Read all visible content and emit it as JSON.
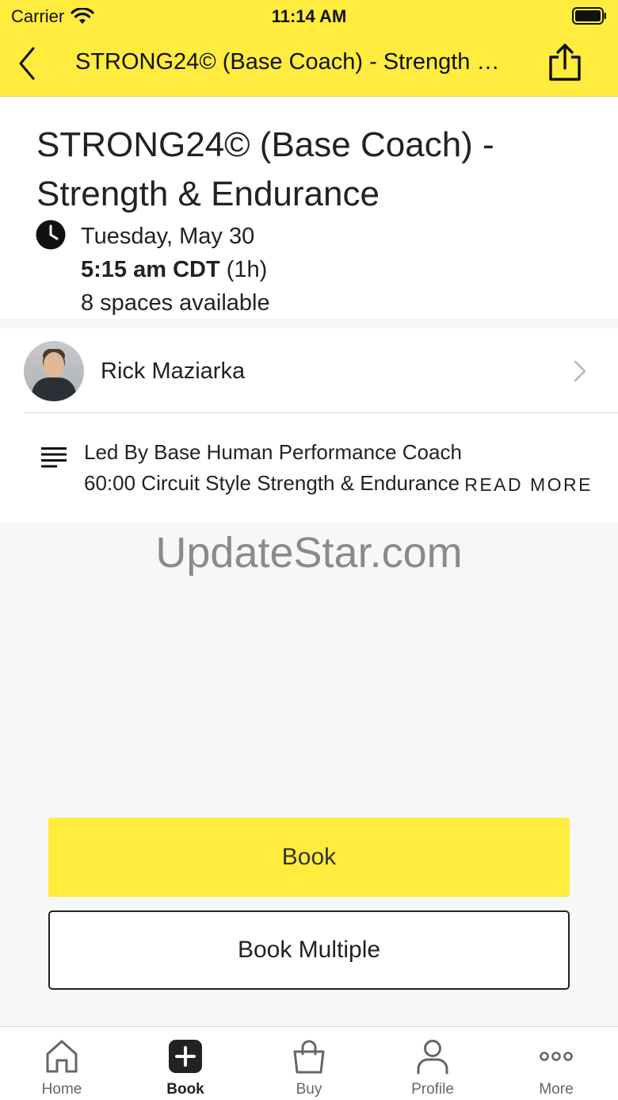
{
  "status_bar": {
    "carrier": "Carrier",
    "time": "11:14 AM"
  },
  "nav": {
    "title": "STRONG24© (Base Coach) - Strength & Endurance"
  },
  "class": {
    "title": "STRONG24© (Base Coach) - Strength & Endurance",
    "date": "Tuesday, May 30",
    "time": "5:15 am CDT",
    "duration": "(1h)",
    "spaces": "8 spaces available"
  },
  "instructor": {
    "name": "Rick Maziarka"
  },
  "description": {
    "line1": "Led By Base Human Performance Coach",
    "line2": "60:00 Circuit Style Strength & Endurance",
    "read_more": "READ MORE"
  },
  "watermark": "UpdateStar.com",
  "buttons": {
    "book": "Book",
    "book_multiple": "Book Multiple"
  },
  "tabs": [
    {
      "label": "Home",
      "icon": "home-icon"
    },
    {
      "label": "Book",
      "icon": "plus-square-icon",
      "active": true
    },
    {
      "label": "Buy",
      "icon": "shopping-bag-icon"
    },
    {
      "label": "Profile",
      "icon": "person-icon"
    },
    {
      "label": "More",
      "icon": "more-dots-icon"
    }
  ],
  "colors": {
    "accent": "#ffec3f",
    "text": "#222222",
    "background": "#f6f7f9"
  }
}
